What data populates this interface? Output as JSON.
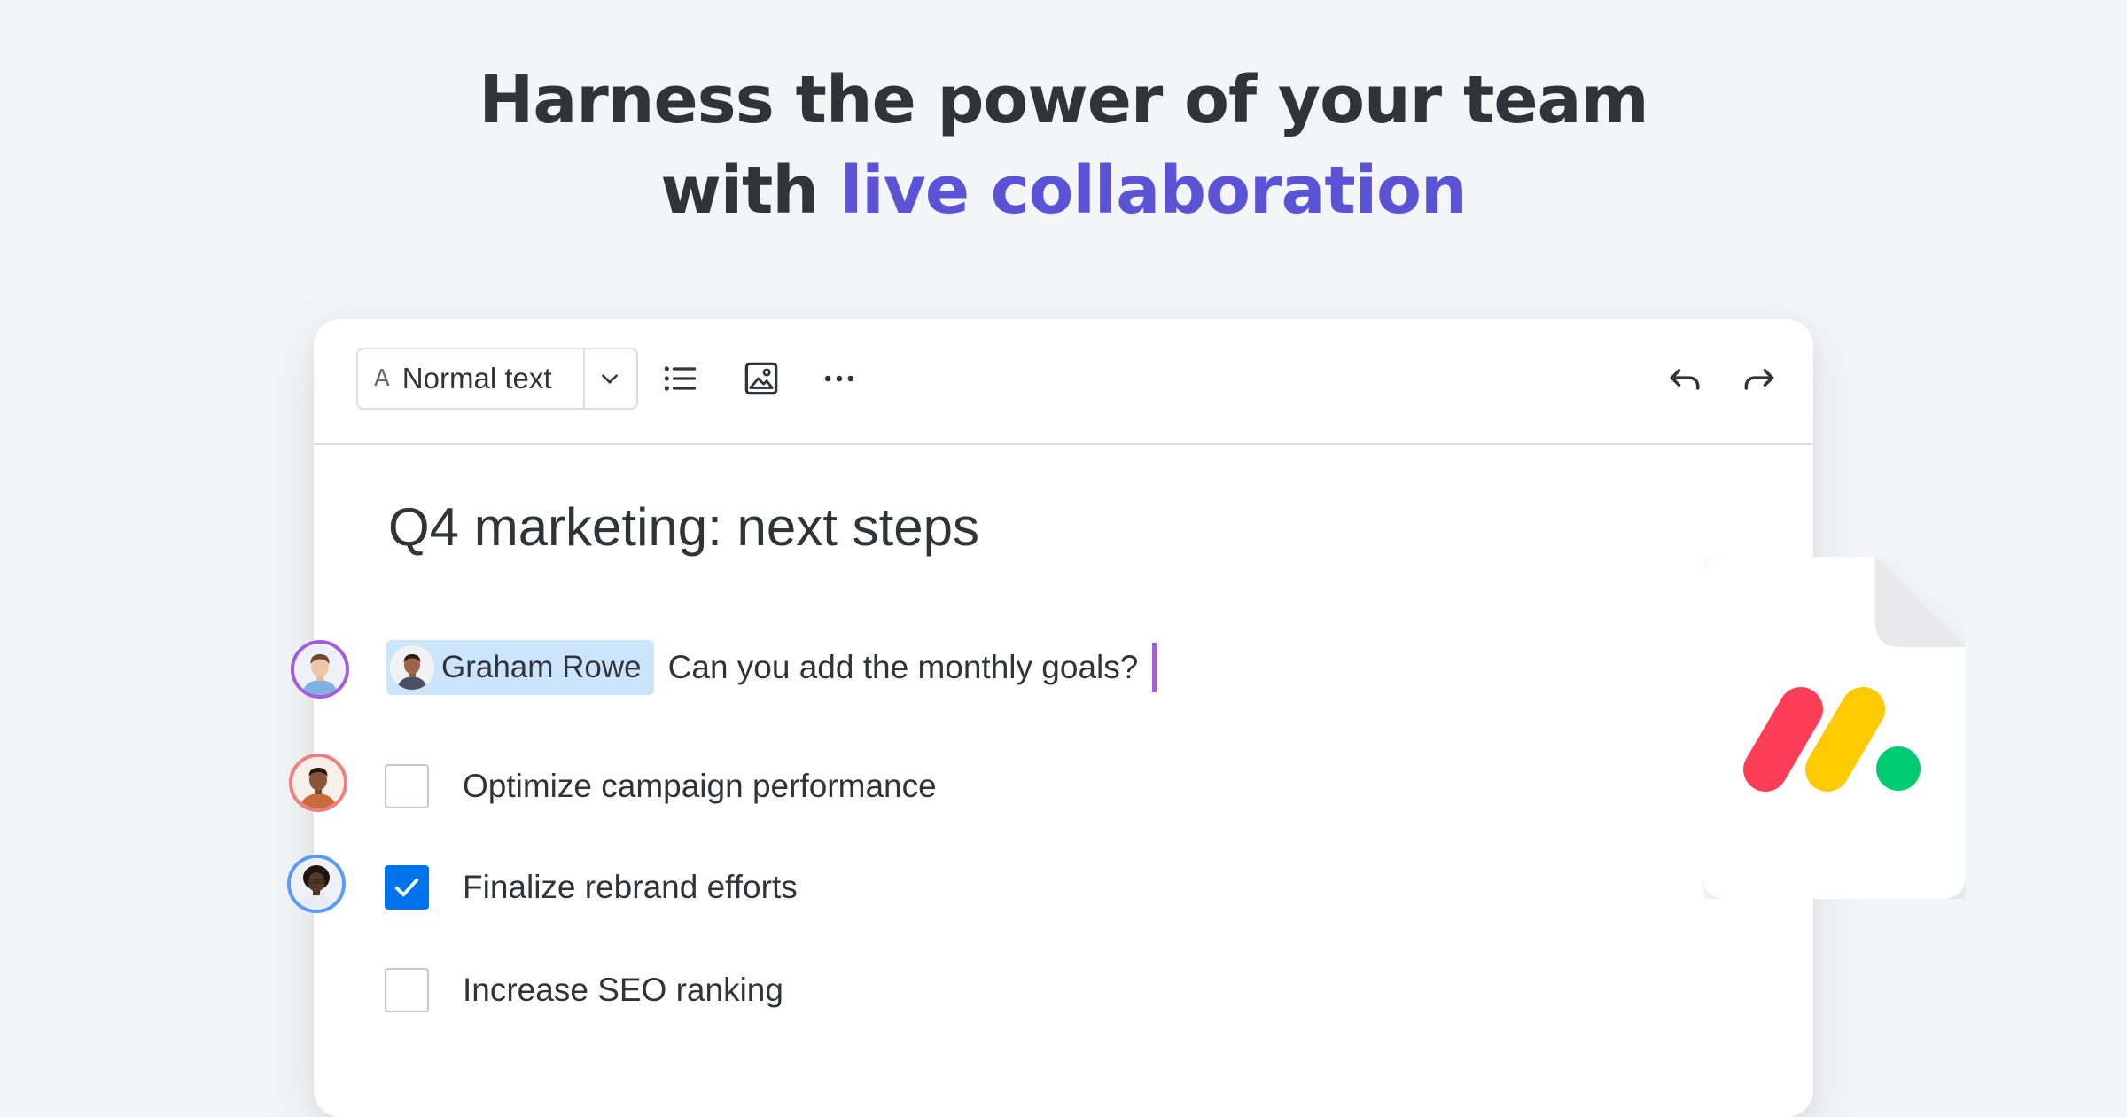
{
  "headline": {
    "line1": "Harness the power of your team",
    "line2_prefix": "with ",
    "line2_accent": "live collaboration"
  },
  "toolbar": {
    "text_style_icon": "A",
    "text_style_label": "Normal text",
    "icons": [
      "chevron-down-icon",
      "bulleted-list-icon",
      "image-icon",
      "more-icon",
      "undo-icon",
      "redo-icon"
    ]
  },
  "document": {
    "title": "Q4 marketing: next steps",
    "mention": {
      "name": "Graham Rowe",
      "message": "Can you add the monthly goals?"
    },
    "tasks": [
      {
        "label": "Optimize campaign performance",
        "checked": false
      },
      {
        "label": "Finalize rebrand efforts",
        "checked": true
      },
      {
        "label": "Increase SEO ranking",
        "checked": false
      }
    ]
  },
  "collaborators": [
    {
      "ring_color": "#a25ddc"
    },
    {
      "ring_color": "#f07f7f"
    },
    {
      "ring_color": "#579bfc"
    }
  ],
  "colors": {
    "accent": "#5a53d6",
    "checkbox_checked": "#0073ea",
    "mention_bg": "#cce5ff",
    "caret": "#a25ddc",
    "logo_red": "#ff3d57",
    "logo_yellow": "#ffcb00",
    "logo_green": "#00ca72"
  }
}
